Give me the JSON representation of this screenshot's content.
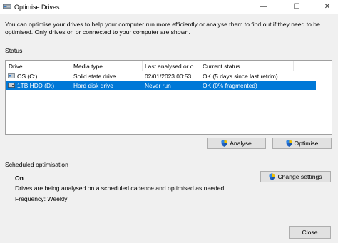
{
  "window": {
    "title": "Optimise Drives",
    "minimize_glyph": "—",
    "maximize_glyph": "☐",
    "close_glyph": "✕"
  },
  "description": "You can optimise your drives to help your computer run more efficiently or analyse them to find out if they need to be optimised. Only drives on or connected to your computer are shown.",
  "status_label": "Status",
  "table": {
    "headers": [
      "Drive",
      "Media type",
      "Last analysed or o...",
      "Current status"
    ],
    "rows": [
      {
        "drive": "OS (C:)",
        "media": "Solid state drive",
        "last": "02/01/2023 00:53",
        "status": "OK (5 days since last retrim)",
        "selected": false,
        "icon": "ssd-drive-icon"
      },
      {
        "drive": "1TB HDD (D:)",
        "media": "Hard disk drive",
        "last": "Never run",
        "status": "OK (0% fragmented)",
        "selected": true,
        "icon": "hdd-drive-icon"
      }
    ]
  },
  "buttons": {
    "analyse": "Analyse",
    "optimise": "Optimise",
    "change_settings": "Change settings",
    "close": "Close"
  },
  "scheduled": {
    "label": "Scheduled optimisation",
    "state": "On",
    "description": "Drives are being analysed on a scheduled cadence and optimised as needed.",
    "frequency": "Frequency: Weekly"
  },
  "colors": {
    "selection": "#0078d7",
    "window_bg": "#f0f0f0",
    "button_bg": "#e1e1e1"
  }
}
